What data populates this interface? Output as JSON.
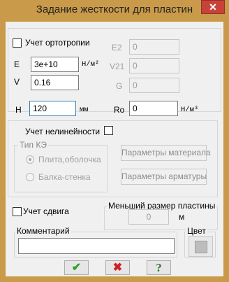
{
  "window": {
    "title": "Задание жесткости для пластин",
    "close_glyph": "✕"
  },
  "orthotropy": {
    "checkbox_label": "Учет ортотропии",
    "E_label": "E",
    "E_value": "3e+10",
    "E_unit": "Н/м²",
    "V_label": "V",
    "V_value": "0.16",
    "E2_label": "E2",
    "E2_value": "0",
    "V21_label": "V21",
    "V21_value": "0",
    "G_label": "G",
    "G_value": "0"
  },
  "thickness": {
    "H_label": "H",
    "H_value": "120",
    "H_unit": "мм",
    "Ro_label": "Ro",
    "Ro_value": "0",
    "Ro_unit": "Н/м³"
  },
  "nonlinearity": {
    "checkbox_label": "Учет нелинейности",
    "fe_type_label": "Тип КЭ",
    "radio_plate": "Плита,оболочка",
    "radio_wall": "Балка-стенка",
    "material_params_button": "Параметры материала",
    "reinforcement_params_button": "Параметры арматуры"
  },
  "shear": {
    "checkbox_label": "Учет сдвига"
  },
  "min_size": {
    "group_label": "Меньший размер пластины",
    "value": "0",
    "unit": "м"
  },
  "comment": {
    "group_label": "Комментарий",
    "value": ""
  },
  "color": {
    "group_label": "Цвет"
  },
  "actions": {
    "ok_glyph": "✔",
    "cancel_glyph": "✖",
    "help_glyph": "?"
  },
  "colors": {
    "frame": "#c99a4a",
    "ok": "#2e9e2e",
    "cancel": "#d02020",
    "help": "#2f7a2f"
  }
}
